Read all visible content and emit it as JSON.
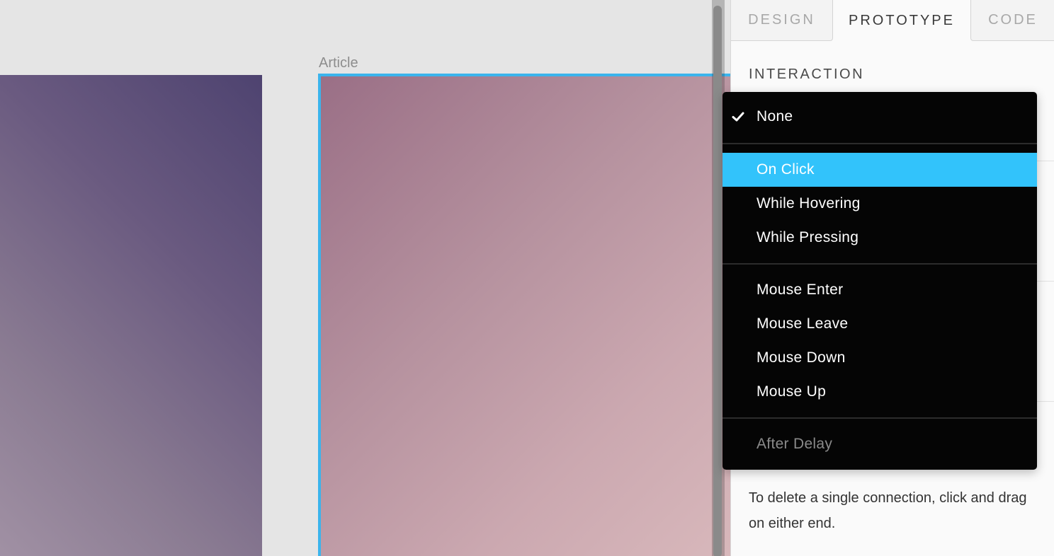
{
  "canvas": {
    "frame_label": "Article"
  },
  "panel": {
    "tabs": [
      {
        "label": "DESIGN"
      },
      {
        "label": "PROTOTYPE"
      },
      {
        "label": "CODE"
      }
    ],
    "active_tab": "PROTOTYPE",
    "section_title": "INTERACTION",
    "help_text": "To delete a single connection, click and drag on either end."
  },
  "dropdown": {
    "selected": "None",
    "highlighted": "On Click",
    "groups": [
      [
        {
          "label": "None",
          "checked": true
        }
      ],
      [
        {
          "label": "On Click"
        },
        {
          "label": "While Hovering"
        },
        {
          "label": "While Pressing"
        }
      ],
      [
        {
          "label": "Mouse Enter"
        },
        {
          "label": "Mouse Leave"
        },
        {
          "label": "Mouse Down"
        },
        {
          "label": "Mouse Up"
        }
      ],
      [
        {
          "label": "After Delay",
          "disabled": true
        }
      ]
    ]
  },
  "colors": {
    "accent": "#32c3fb",
    "selection_border": "#3bb4ec",
    "menu_bg": "#050505"
  }
}
